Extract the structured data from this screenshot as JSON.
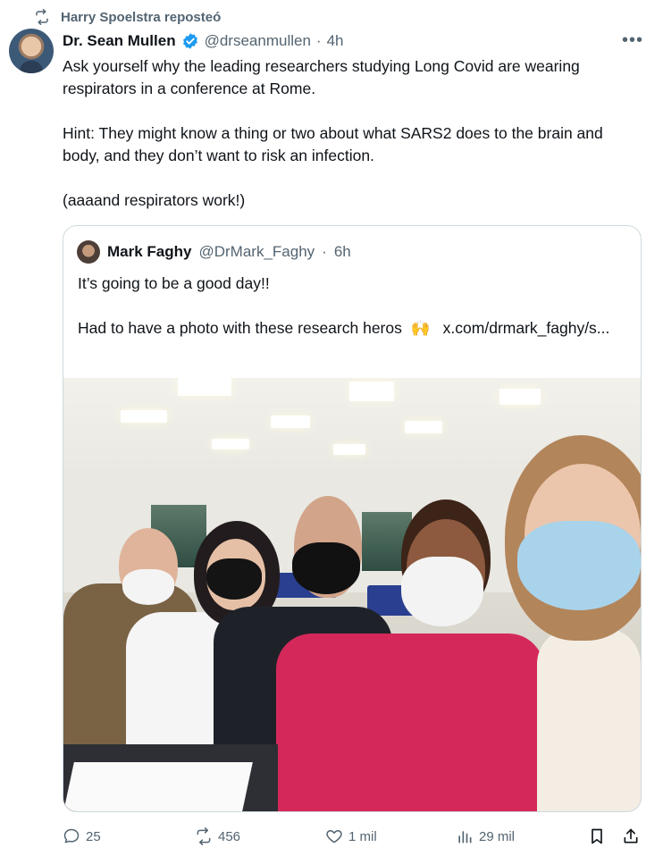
{
  "repost": {
    "label": "Harry Spoelstra reposteó"
  },
  "tweet": {
    "name": "Dr. Sean Mullen",
    "handle": "@drseanmullen",
    "time": "4h",
    "more": "•••",
    "paragraphs": [
      "Ask yourself why the leading researchers studying Long Covid are wearing respirators in a conference at Rome.",
      "Hint: They might know a thing or two about what SARS2 does to the brain and body, and they don’t want to risk an infection.",
      "(aaaand respirators work!)"
    ]
  },
  "quote": {
    "name": "Mark Faghy",
    "handle": "@DrMark_Faghy",
    "time": "6h",
    "line1": "It’s going to be a good day!!",
    "line2_text": "Had to have a photo with these research heros",
    "line2_emoji": "🙌",
    "line2_link": "x.com/drmark_faghy/s..."
  },
  "actions": {
    "replies": "25",
    "reposts": "456",
    "likes": "1 mil",
    "views": "29 mil"
  },
  "colors": {
    "accent": "#1d9bf0",
    "muted": "#536471",
    "text": "#0f1419",
    "border": "#cfd9de"
  }
}
